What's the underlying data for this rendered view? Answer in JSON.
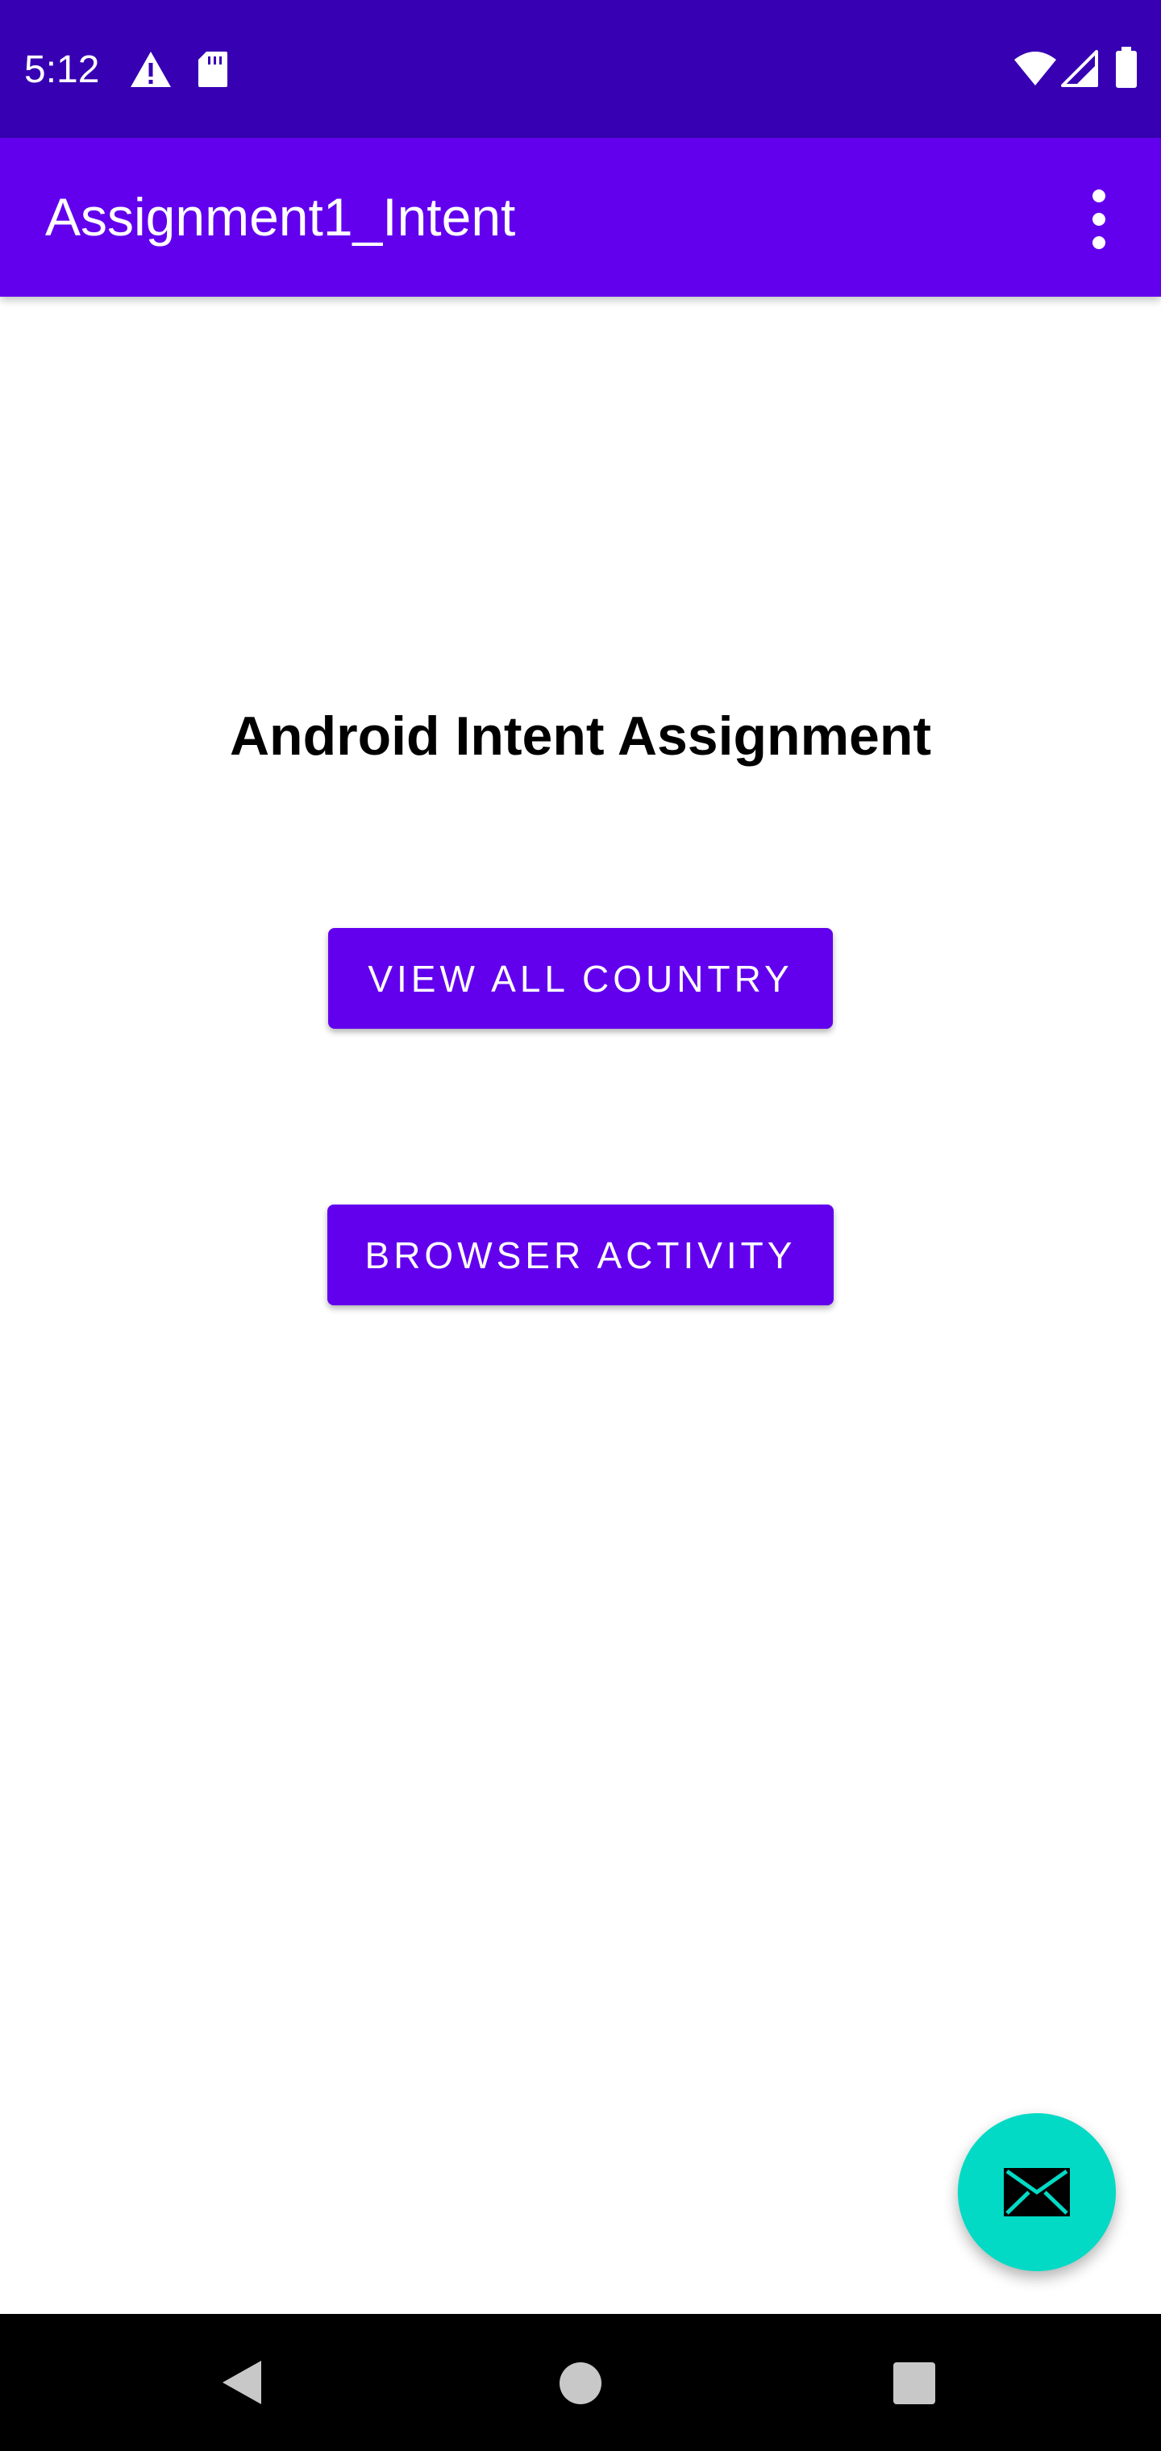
{
  "status_bar": {
    "time": "5:12",
    "left_icons": [
      "alert-icon",
      "sd-card-icon"
    ],
    "right_icons": [
      "wifi-icon",
      "signal-icon",
      "battery-icon"
    ],
    "background_color": "#3700b3"
  },
  "app_bar": {
    "title": "Assignment1_Intent",
    "menu_icon": "more-vert-icon",
    "background_color": "#6200ee"
  },
  "main": {
    "heading": "Android Intent Assignment",
    "buttons": [
      {
        "label": "VIEW ALL COUNTRY"
      },
      {
        "label": "BROWSER ACTIVITY"
      }
    ],
    "button_color": "#6200ee"
  },
  "fab": {
    "icon": "email-icon",
    "color": "#03dac5"
  },
  "nav_bar": {
    "icons": [
      "back-icon",
      "home-icon",
      "recents-icon"
    ]
  }
}
